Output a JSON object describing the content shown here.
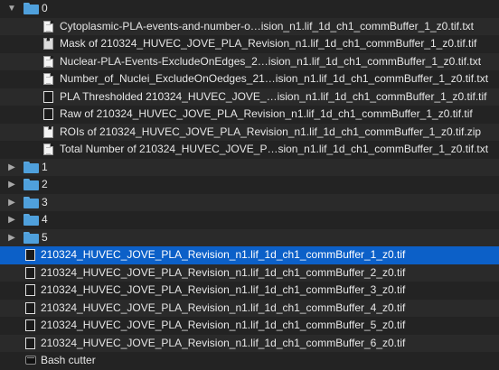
{
  "window": {
    "rows": [
      {
        "name": "0",
        "kind": "folder",
        "expanded": true,
        "depth": 0
      },
      {
        "name": "Cytoplasmic-PLA-events-and-number-o…ision_n1.lif_1d_ch1_commBuffer_1_z0.tif.txt",
        "kind": "txt",
        "depth": 1
      },
      {
        "name": "Mask of 210324_HUVEC_JOVE_PLA_Revision_n1.lif_1d_ch1_commBuffer_1_z0.tif.tif",
        "kind": "img",
        "depth": 1
      },
      {
        "name": "Nuclear-PLA-Events-ExcludeOnEdges_2…ision_n1.lif_1d_ch1_commBuffer_1_z0.tif.txt",
        "kind": "txt",
        "depth": 1
      },
      {
        "name": "Number_of_Nuclei_ExcludeOnOedges_21…ision_n1.lif_1d_ch1_commBuffer_1_z0.tif.txt",
        "kind": "txt",
        "depth": 1
      },
      {
        "name": "PLA Thresholded 210324_HUVEC_JOVE_…ision_n1.lif_1d_ch1_commBuffer_1_z0.tif.tif",
        "kind": "tif",
        "depth": 1
      },
      {
        "name": "Raw of 210324_HUVEC_JOVE_PLA_Revision_n1.lif_1d_ch1_commBuffer_1_z0.tif.tif",
        "kind": "tif",
        "depth": 1
      },
      {
        "name": "ROIs of 210324_HUVEC_JOVE_PLA_Revision_n1.lif_1d_ch1_commBuffer_1_z0.tif.zip",
        "kind": "zip",
        "depth": 1
      },
      {
        "name": "Total Number of 210324_HUVEC_JOVE_P…sion_n1.lif_1d_ch1_commBuffer_1_z0.tif.txt",
        "kind": "txt",
        "depth": 1
      },
      {
        "name": "1",
        "kind": "folder",
        "expanded": false,
        "depth": 0
      },
      {
        "name": "2",
        "kind": "folder",
        "expanded": false,
        "depth": 0
      },
      {
        "name": "3",
        "kind": "folder",
        "expanded": false,
        "depth": 0
      },
      {
        "name": "4",
        "kind": "folder",
        "expanded": false,
        "depth": 0
      },
      {
        "name": "5",
        "kind": "folder",
        "expanded": false,
        "depth": 0
      },
      {
        "name": "210324_HUVEC_JOVE_PLA_Revision_n1.lif_1d_ch1_commBuffer_1_z0.tif",
        "kind": "tif",
        "depth": 0,
        "selected": true
      },
      {
        "name": "210324_HUVEC_JOVE_PLA_Revision_n1.lif_1d_ch1_commBuffer_2_z0.tif",
        "kind": "tif",
        "depth": 0
      },
      {
        "name": "210324_HUVEC_JOVE_PLA_Revision_n1.lif_1d_ch1_commBuffer_3_z0.tif",
        "kind": "tif",
        "depth": 0
      },
      {
        "name": "210324_HUVEC_JOVE_PLA_Revision_n1.lif_1d_ch1_commBuffer_4_z0.tif",
        "kind": "tif",
        "depth": 0
      },
      {
        "name": "210324_HUVEC_JOVE_PLA_Revision_n1.lif_1d_ch1_commBuffer_5_z0.tif",
        "kind": "tif",
        "depth": 0
      },
      {
        "name": "210324_HUVEC_JOVE_PLA_Revision_n1.lif_1d_ch1_commBuffer_6_z0.tif",
        "kind": "tif",
        "depth": 0
      },
      {
        "name": "Bash cutter",
        "kind": "exec",
        "depth": 0
      }
    ]
  }
}
